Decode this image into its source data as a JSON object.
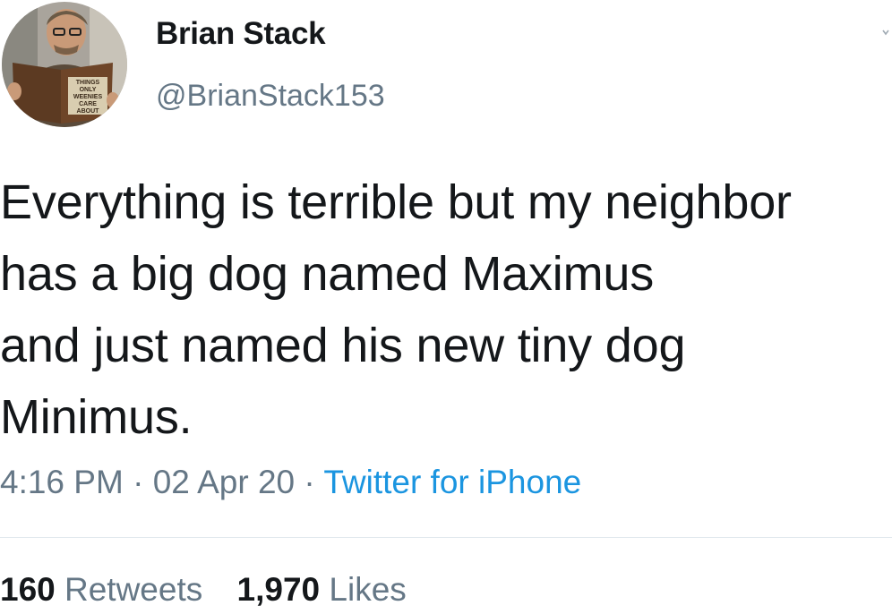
{
  "author": {
    "display_name": "Brian Stack",
    "handle": "@BrianStack153",
    "avatar_book_text": [
      "THINGS",
      "ONLY",
      "WEENIES",
      "CARE",
      "ABOUT"
    ]
  },
  "tweet": {
    "lines": [
      "Everything is terrible but my neighbor",
      "has a big dog named Maximus",
      "and just named his new tiny dog",
      "Minimus."
    ]
  },
  "meta": {
    "time": "4:16 PM",
    "separator": " · ",
    "date": "02 Apr 20",
    "source": "Twitter for iPhone"
  },
  "stats": {
    "retweets_count": "160",
    "retweets_label": " Retweets",
    "likes_count": "1,970",
    "likes_label": " Likes"
  },
  "colors": {
    "text": "#14171a",
    "secondary": "#657786",
    "link": "#1b95e0",
    "divider": "#e1e8ed"
  },
  "icons": {
    "menu": "chevron-down-icon"
  }
}
